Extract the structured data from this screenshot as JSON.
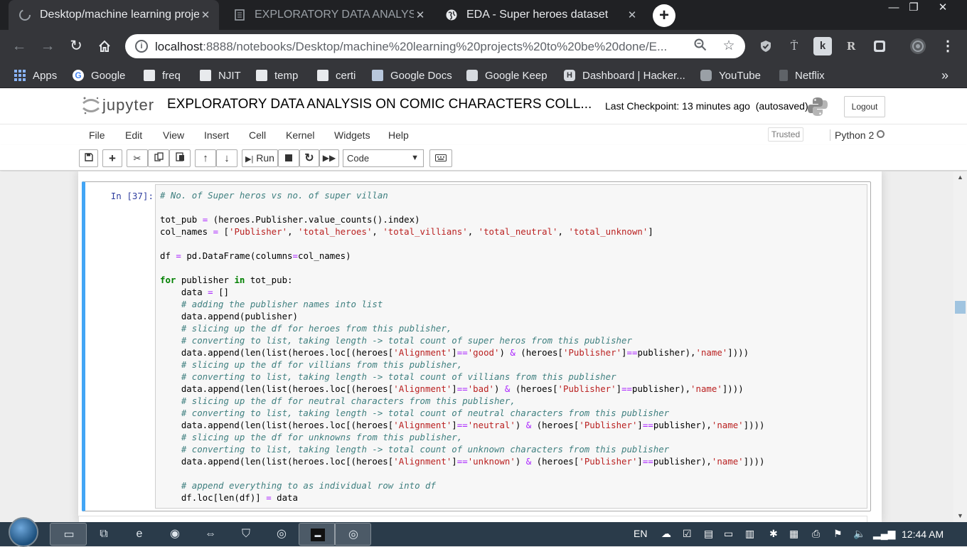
{
  "browser": {
    "tabs": [
      {
        "title": "Desktop/machine learning projec",
        "state": "active"
      },
      {
        "title": "EXPLORATORY DATA ANALYSIS",
        "state": "inactive"
      },
      {
        "title": "EDA - Super heroes dataset",
        "state": "inactive"
      }
    ],
    "new_tab_label": "+",
    "window_controls": {
      "minimize": "—",
      "restore": "❐",
      "close": "✕"
    },
    "url_host": "localhost",
    "url_rest": ":8888/notebooks/Desktop/machine%20learning%20projects%20to%20be%20done/E...",
    "bookmarks": [
      "Apps",
      "Google",
      "freq",
      "NJIT",
      "temp",
      "certi",
      "Google Docs",
      "Google Keep",
      "Dashboard | Hacker...",
      "YouTube",
      "Netflix"
    ],
    "bookmarks_overflow": "»"
  },
  "jupyter": {
    "logo_text": "jupyter",
    "notebook_title": "EXPLORATORY DATA ANALYSIS ON COMIC CHARACTERS COLL...",
    "checkpoint": "Last Checkpoint: 13 minutes ago",
    "autosave": "(autosaved)",
    "logout_label": "Logout",
    "menu": [
      "File",
      "Edit",
      "View",
      "Insert",
      "Cell",
      "Kernel",
      "Widgets",
      "Help"
    ],
    "trusted_label": "Trusted",
    "kernel_name": "Python 2",
    "run_label": "Run",
    "cell_type": "Code"
  },
  "cell": {
    "prompt": "In [37]:",
    "lines": [
      [
        {
          "t": "# No. of Super heros vs no. of super villan",
          "c": "cm"
        }
      ],
      [],
      [
        {
          "t": "tot_pub "
        },
        {
          "t": "=",
          "c": "op"
        },
        {
          "t": " (heroes.Publisher.value_counts().index)"
        }
      ],
      [
        {
          "t": "col_names "
        },
        {
          "t": "=",
          "c": "op"
        },
        {
          "t": " ["
        },
        {
          "t": "'Publisher'",
          "c": "st"
        },
        {
          "t": ", "
        },
        {
          "t": "'total_heroes'",
          "c": "st"
        },
        {
          "t": ", "
        },
        {
          "t": "'total_villians'",
          "c": "st"
        },
        {
          "t": ", "
        },
        {
          "t": "'total_neutral'",
          "c": "st"
        },
        {
          "t": ", "
        },
        {
          "t": "'total_unknown'",
          "c": "st"
        },
        {
          "t": "]"
        }
      ],
      [],
      [
        {
          "t": "df "
        },
        {
          "t": "=",
          "c": "op"
        },
        {
          "t": " pd.DataFrame(columns"
        },
        {
          "t": "=",
          "c": "op"
        },
        {
          "t": "col_names)"
        }
      ],
      [],
      [
        {
          "t": "for",
          "c": "kw"
        },
        {
          "t": " publisher "
        },
        {
          "t": "in",
          "c": "kw"
        },
        {
          "t": " tot_pub:"
        }
      ],
      [
        {
          "t": "    data "
        },
        {
          "t": "=",
          "c": "op"
        },
        {
          "t": " []"
        }
      ],
      [
        {
          "t": "    "
        },
        {
          "t": "# adding the publisher names into list",
          "c": "cm"
        }
      ],
      [
        {
          "t": "    data.append(publisher)"
        }
      ],
      [
        {
          "t": "    "
        },
        {
          "t": "# slicing up the df for heroes from this publisher,",
          "c": "cm"
        }
      ],
      [
        {
          "t": "    "
        },
        {
          "t": "# converting to list, taking length -> total count of super heros from this publisher",
          "c": "cm"
        }
      ],
      [
        {
          "t": "    data.append(len(list(heroes.loc[(heroes["
        },
        {
          "t": "'Alignment'",
          "c": "st"
        },
        {
          "t": "]"
        },
        {
          "t": "==",
          "c": "op"
        },
        {
          "t": "'good'",
          "c": "st"
        },
        {
          "t": ") "
        },
        {
          "t": "&",
          "c": "op"
        },
        {
          "t": " (heroes["
        },
        {
          "t": "'Publisher'",
          "c": "st"
        },
        {
          "t": "]"
        },
        {
          "t": "==",
          "c": "op"
        },
        {
          "t": "publisher),"
        },
        {
          "t": "'name'",
          "c": "st"
        },
        {
          "t": "])))"
        }
      ],
      [
        {
          "t": "    "
        },
        {
          "t": "# slicing up the df for villians from this publisher,",
          "c": "cm"
        }
      ],
      [
        {
          "t": "    "
        },
        {
          "t": "# converting to list, taking length -> total count of villians from this publisher",
          "c": "cm"
        }
      ],
      [
        {
          "t": "    data.append(len(list(heroes.loc[(heroes["
        },
        {
          "t": "'Alignment'",
          "c": "st"
        },
        {
          "t": "]"
        },
        {
          "t": "==",
          "c": "op"
        },
        {
          "t": "'bad'",
          "c": "st"
        },
        {
          "t": ") "
        },
        {
          "t": "&",
          "c": "op"
        },
        {
          "t": " (heroes["
        },
        {
          "t": "'Publisher'",
          "c": "st"
        },
        {
          "t": "]"
        },
        {
          "t": "==",
          "c": "op"
        },
        {
          "t": "publisher),"
        },
        {
          "t": "'name'",
          "c": "st"
        },
        {
          "t": "])))"
        }
      ],
      [
        {
          "t": "    "
        },
        {
          "t": "# slicing up the df for neutral characters from this publisher,",
          "c": "cm"
        }
      ],
      [
        {
          "t": "    "
        },
        {
          "t": "# converting to list, taking length -> total count of neutral characters from this publisher",
          "c": "cm"
        }
      ],
      [
        {
          "t": "    data.append(len(list(heroes.loc[(heroes["
        },
        {
          "t": "'Alignment'",
          "c": "st"
        },
        {
          "t": "]"
        },
        {
          "t": "==",
          "c": "op"
        },
        {
          "t": "'neutral'",
          "c": "st"
        },
        {
          "t": ") "
        },
        {
          "t": "&",
          "c": "op"
        },
        {
          "t": " (heroes["
        },
        {
          "t": "'Publisher'",
          "c": "st"
        },
        {
          "t": "]"
        },
        {
          "t": "==",
          "c": "op"
        },
        {
          "t": "publisher),"
        },
        {
          "t": "'name'",
          "c": "st"
        },
        {
          "t": "])))"
        }
      ],
      [
        {
          "t": "    "
        },
        {
          "t": "# slicing up the df for unknowns from this publisher,",
          "c": "cm"
        }
      ],
      [
        {
          "t": "    "
        },
        {
          "t": "# converting to list, taking length -> total count of unknown characters from this publisher",
          "c": "cm"
        }
      ],
      [
        {
          "t": "    data.append(len(list(heroes.loc[(heroes["
        },
        {
          "t": "'Alignment'",
          "c": "st"
        },
        {
          "t": "]"
        },
        {
          "t": "==",
          "c": "op"
        },
        {
          "t": "'unknown'",
          "c": "st"
        },
        {
          "t": ") "
        },
        {
          "t": "&",
          "c": "op"
        },
        {
          "t": " (heroes["
        },
        {
          "t": "'Publisher'",
          "c": "st"
        },
        {
          "t": "]"
        },
        {
          "t": "==",
          "c": "op"
        },
        {
          "t": "publisher),"
        },
        {
          "t": "'name'",
          "c": "st"
        },
        {
          "t": "])))"
        }
      ],
      [],
      [
        {
          "t": "    "
        },
        {
          "t": "# append everything to as individual row into df",
          "c": "cm"
        }
      ],
      [
        {
          "t": "    df.loc[len(df)] "
        },
        {
          "t": "=",
          "c": "op"
        },
        {
          "t": " data"
        }
      ]
    ]
  },
  "taskbar": {
    "language": "EN",
    "time": "12:44 AM"
  },
  "colors": {
    "cell_border_active": "#42a5f5",
    "prompt": "#303f9f",
    "comment": "#408080",
    "keyword": "#008000",
    "string": "#ba2121",
    "operator": "#aa22ff"
  }
}
